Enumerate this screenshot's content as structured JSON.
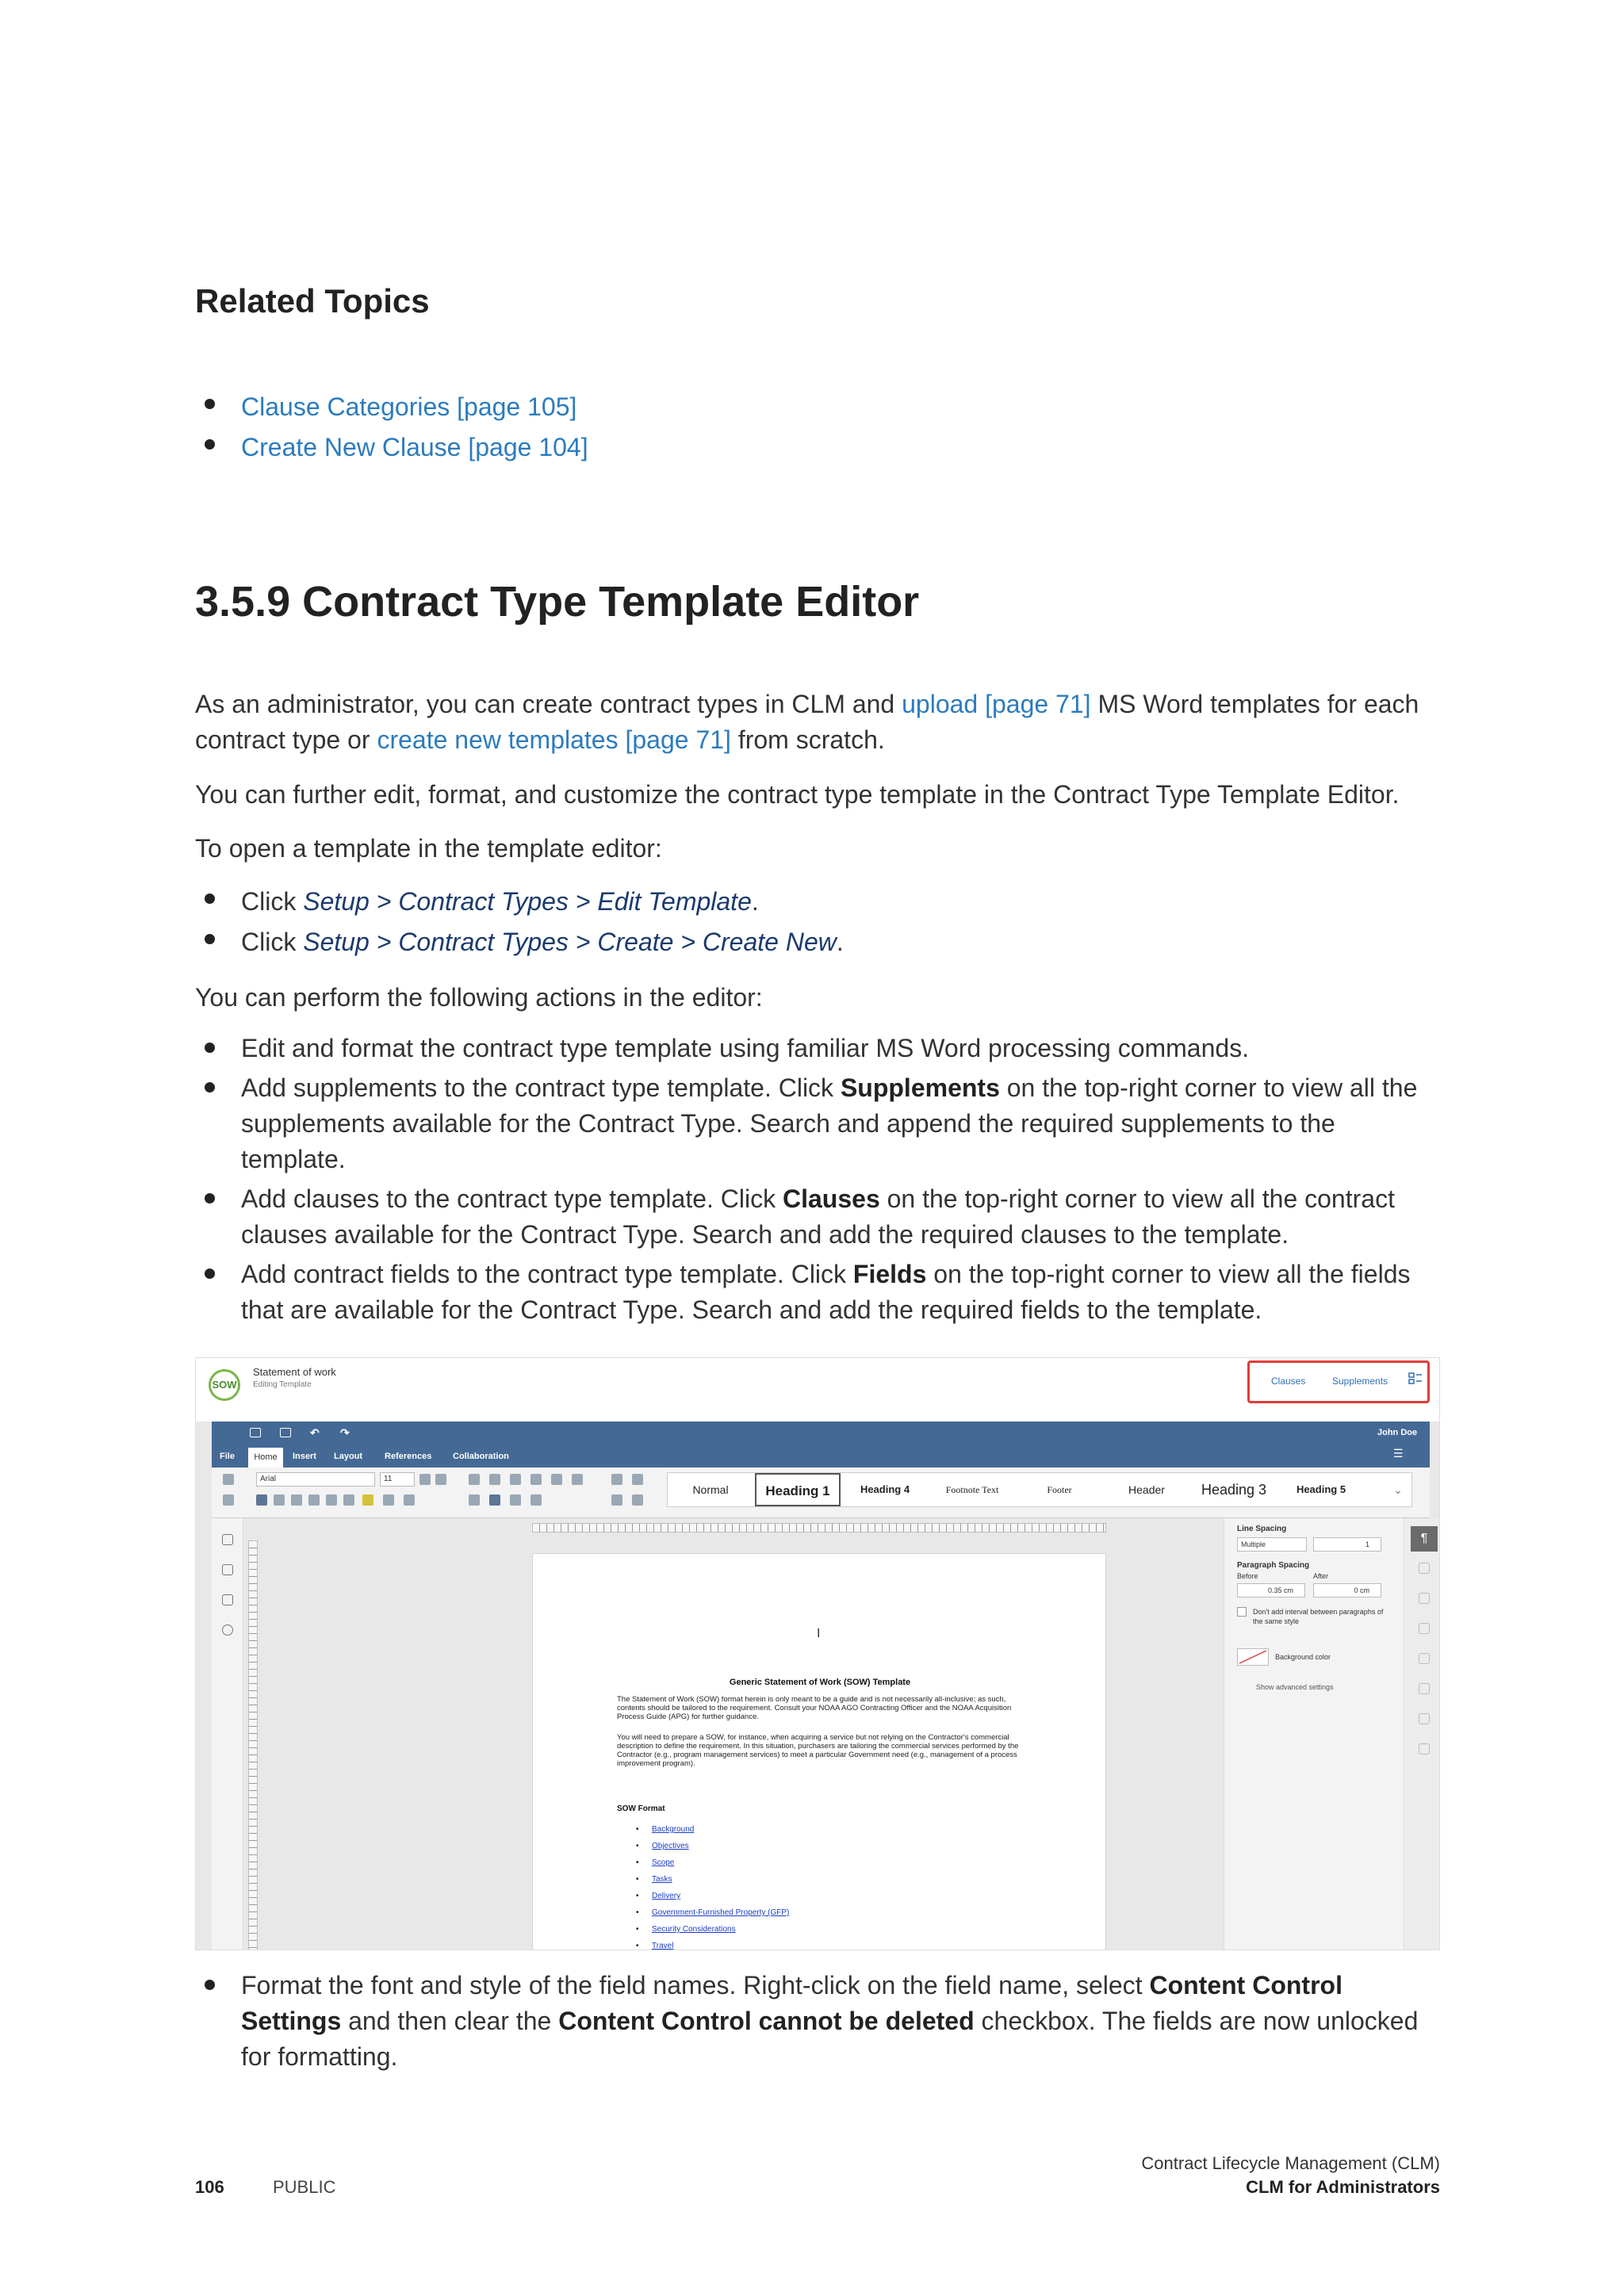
{
  "related": {
    "heading": "Related Topics",
    "links": [
      "Clause Categories [page 105]",
      "Create New Clause [page 104]"
    ]
  },
  "section": {
    "title": "3.5.9  Contract Type Template Editor",
    "p1_a": "As an administrator, you can create contract types in CLM and ",
    "p1_link1": "upload [page 71]",
    "p1_b": " MS Word templates for each contract type or ",
    "p1_link2": "create new templates [page 71]",
    "p1_c": " from scratch.",
    "p2": "You can further edit, format, and customize the contract type template in the Contract Type Template Editor.",
    "p3": "To open a template in the template editor:",
    "open_steps": [
      {
        "pre": "Click ",
        "path": "Setup > Contract Types > Edit Template",
        "post": "."
      },
      {
        "pre": "Click ",
        "path": "Setup > Contract Types > Create > Create New",
        "post": "."
      }
    ],
    "p4": "You can perform the following actions in the editor:",
    "actions": [
      {
        "a": "Edit and format the contract type template using familiar MS Word processing commands.",
        "b": "",
        "c": ""
      },
      {
        "a": "Add supplements to the contract type template. Click ",
        "b": "Supplements",
        "c": " on the top-right corner to view all the supplements available for the Contract Type. Search and append the required supplements to the template."
      },
      {
        "a": "Add clauses to the contract type template. Click ",
        "b": "Clauses",
        "c": " on the top-right corner to view all the contract clauses available for the Contract Type. Search and add the required clauses to the template."
      },
      {
        "a": "Add contract fields to the contract type template. Click ",
        "b": "Fields",
        "c": " on the top-right corner to view all the fields that are available for the Contract Type. Search and add the required fields to the template."
      }
    ],
    "after": {
      "a": "Format the font and style of the field names. Right-click on the field name, select ",
      "b1": "Content Control Settings",
      "c": " and then clear the ",
      "b2": "Content Control cannot be deleted",
      "d": " checkbox. The fields are now unlocked for formatting."
    }
  },
  "screenshot": {
    "logo": "SOW",
    "title": "Statement of work",
    "subtitle": "Editing Template",
    "top_tabs": {
      "clauses": "Clauses",
      "supplements": "Supplements"
    },
    "user": "John Doe",
    "menu": [
      "File",
      "Home",
      "Insert",
      "Layout",
      "References",
      "Collaboration"
    ],
    "font": "Arial",
    "font_size": "11",
    "styles": [
      "Normal",
      "Heading 1",
      "Heading 4",
      "Footnote Text",
      "Footer",
      "Header",
      "Heading 3",
      "Heading 5"
    ],
    "doc": {
      "title": "Generic Statement of Work (SOW) Template",
      "para1": "The Statement of Work (SOW) format herein is only meant to be a guide and is not necessarily all-inclusive; as such, contents should be tailored to the requirement. Consult your NOAA AGO Contracting Officer and the NOAA Acquisition Process Guide (APG) for further guidance.",
      "para2": "You will need to prepare a SOW, for instance, when acquiring a service but not relying on the Contractor's commercial description to define the requirement. In this situation, purchasers are tailoring the commercial services performed by the Contractor (e.g., program management services) to meet a particular Government need (e.g., management of a process improvement program).",
      "format_heading": "SOW Format",
      "items": [
        "Background",
        "Objectives",
        "Scope",
        "Tasks",
        "Delivery",
        "Government-Furnished Property (GFP)",
        "Security Considerations",
        "Travel"
      ]
    },
    "right_panel": {
      "line_spacing": "Line Spacing",
      "line_mode": "Multiple",
      "line_value": "1",
      "para_spacing": "Paragraph Spacing",
      "before": "Before",
      "after": "After",
      "before_val": "0.35 cm",
      "after_val": "0 cm",
      "dont_add": "Don't add interval between paragraphs of the same style",
      "bg_color": "Background color",
      "advanced": "Show advanced settings"
    }
  },
  "footer": {
    "page_number": "106",
    "classification": "PUBLIC",
    "product": "Contract Lifecycle Management (CLM)",
    "guide": "CLM for Administrators"
  }
}
